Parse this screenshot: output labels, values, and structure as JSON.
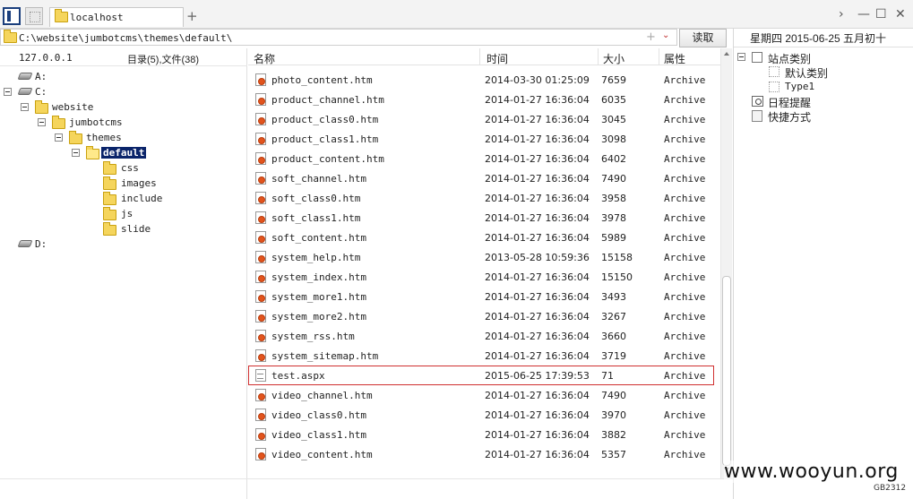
{
  "tab": {
    "label": "localhost",
    "add": "+"
  },
  "window": {
    "nav_next": "›",
    "minimize": "—",
    "maximize": "☐",
    "close": "✕"
  },
  "address": {
    "path": "C:\\website\\jumbotcms\\themes\\default\\",
    "plus": "+",
    "dropdown": "⌄"
  },
  "read_button": "读取",
  "left": {
    "ip": "127.0.0.1",
    "counts": "目录(5),文件(38)",
    "tree": [
      {
        "label": "A:",
        "kind": "drive"
      },
      {
        "label": "C:",
        "kind": "drive"
      },
      {
        "label": "website",
        "kind": "folder"
      },
      {
        "label": "jumbotcms",
        "kind": "folder"
      },
      {
        "label": "themes",
        "kind": "folder"
      },
      {
        "label": "default",
        "kind": "folder",
        "selected": true
      },
      {
        "label": "css",
        "kind": "folder"
      },
      {
        "label": "images",
        "kind": "folder"
      },
      {
        "label": "include",
        "kind": "folder"
      },
      {
        "label": "js",
        "kind": "folder"
      },
      {
        "label": "slide",
        "kind": "folder"
      },
      {
        "label": "D:",
        "kind": "drive"
      }
    ]
  },
  "list": {
    "columns": {
      "name": "名称",
      "time": "时间",
      "size": "大小",
      "attr": "属性"
    },
    "rows": [
      {
        "name": "photo_content.htm",
        "time": "2014-03-30 01:25:09",
        "size": "7659",
        "attr": "Archive"
      },
      {
        "name": "product_channel.htm",
        "time": "2014-01-27 16:36:04",
        "size": "6035",
        "attr": "Archive"
      },
      {
        "name": "product_class0.htm",
        "time": "2014-01-27 16:36:04",
        "size": "3045",
        "attr": "Archive"
      },
      {
        "name": "product_class1.htm",
        "time": "2014-01-27 16:36:04",
        "size": "3098",
        "attr": "Archive"
      },
      {
        "name": "product_content.htm",
        "time": "2014-01-27 16:36:04",
        "size": "6402",
        "attr": "Archive"
      },
      {
        "name": "soft_channel.htm",
        "time": "2014-01-27 16:36:04",
        "size": "7490",
        "attr": "Archive"
      },
      {
        "name": "soft_class0.htm",
        "time": "2014-01-27 16:36:04",
        "size": "3958",
        "attr": "Archive"
      },
      {
        "name": "soft_class1.htm",
        "time": "2014-01-27 16:36:04",
        "size": "3978",
        "attr": "Archive"
      },
      {
        "name": "soft_content.htm",
        "time": "2014-01-27 16:36:04",
        "size": "5989",
        "attr": "Archive"
      },
      {
        "name": "system_help.htm",
        "time": "2013-05-28 10:59:36",
        "size": "15158",
        "attr": "Archive"
      },
      {
        "name": "system_index.htm",
        "time": "2014-01-27 16:36:04",
        "size": "15150",
        "attr": "Archive"
      },
      {
        "name": "system_more1.htm",
        "time": "2014-01-27 16:36:04",
        "size": "3493",
        "attr": "Archive"
      },
      {
        "name": "system_more2.htm",
        "time": "2014-01-27 16:36:04",
        "size": "3267",
        "attr": "Archive"
      },
      {
        "name": "system_rss.htm",
        "time": "2014-01-27 16:36:04",
        "size": "3660",
        "attr": "Archive"
      },
      {
        "name": "system_sitemap.htm",
        "time": "2014-01-27 16:36:04",
        "size": "3719",
        "attr": "Archive"
      },
      {
        "name": "test.aspx",
        "time": "2015-06-25 17:39:53",
        "size": "71",
        "attr": "Archive",
        "highlight": true
      },
      {
        "name": "video_channel.htm",
        "time": "2014-01-27 16:36:04",
        "size": "7490",
        "attr": "Archive"
      },
      {
        "name": "video_class0.htm",
        "time": "2014-01-27 16:36:04",
        "size": "3970",
        "attr": "Archive"
      },
      {
        "name": "video_class1.htm",
        "time": "2014-01-27 16:36:04",
        "size": "3882",
        "attr": "Archive"
      },
      {
        "name": "video_content.htm",
        "time": "2014-01-27 16:36:04",
        "size": "5357",
        "attr": "Archive"
      }
    ]
  },
  "right": {
    "date": "星期四 2015-06-25 五月初十",
    "site_category": "站点类别",
    "default_category": "默认类别",
    "type1": "Type1",
    "schedule": "日程提醒",
    "shortcuts": "快捷方式"
  },
  "watermark": "www.wooyun.org",
  "encoding": "GB2312",
  "colors": {
    "selection": "#0a246a",
    "highlight_border": "#d03030",
    "folder": "#f5d55c"
  }
}
